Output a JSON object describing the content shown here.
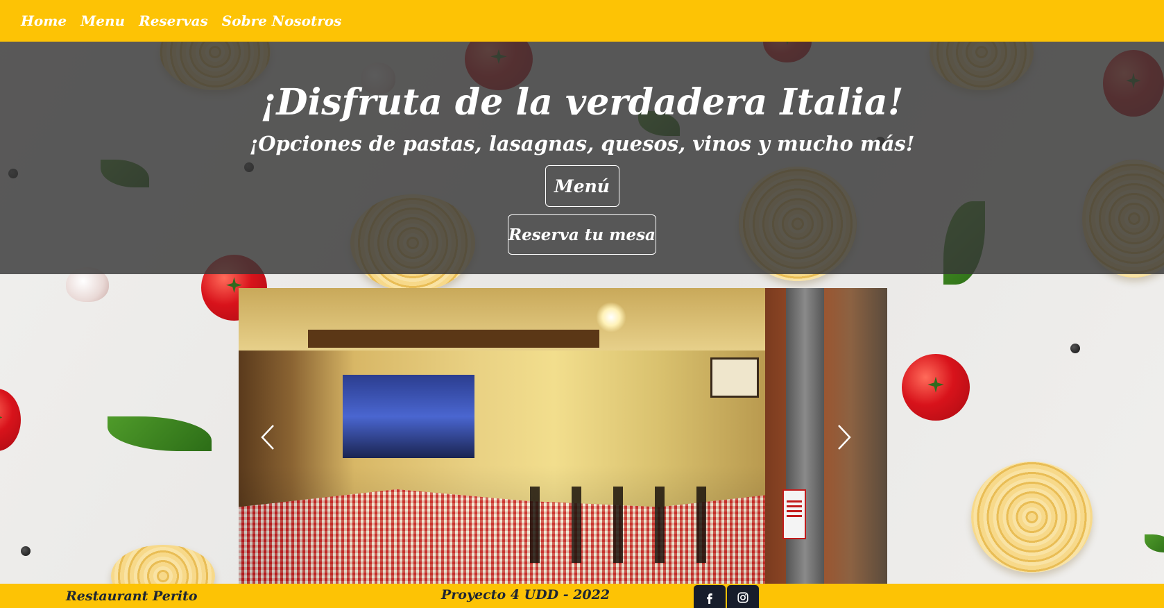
{
  "navbar": {
    "links": [
      {
        "label": "Home"
      },
      {
        "label": "Menu"
      },
      {
        "label": "Reservas"
      },
      {
        "label": "Sobre Nosotros"
      }
    ]
  },
  "hero": {
    "title": "¡Disfruta de la verdadera Italia!",
    "subtitle": "¡Opciones de pastas, lasagnas, quesos, vinos y mucho más!",
    "menu_button": "Menú",
    "reserve_button": "Reserva tu mesa"
  },
  "carousel": {
    "prev_icon": "chevron-left-icon",
    "next_icon": "chevron-right-icon"
  },
  "footer": {
    "brand": "Restaurant Perito",
    "project": "Proyecto 4 UDD - 2022",
    "social": [
      {
        "icon": "facebook-icon"
      },
      {
        "icon": "instagram-icon"
      }
    ]
  },
  "colors": {
    "navbar": "#fdc305",
    "hero_overlay": "#373737",
    "footer_text": "#1f2633",
    "social_bg": "#171d2b"
  }
}
